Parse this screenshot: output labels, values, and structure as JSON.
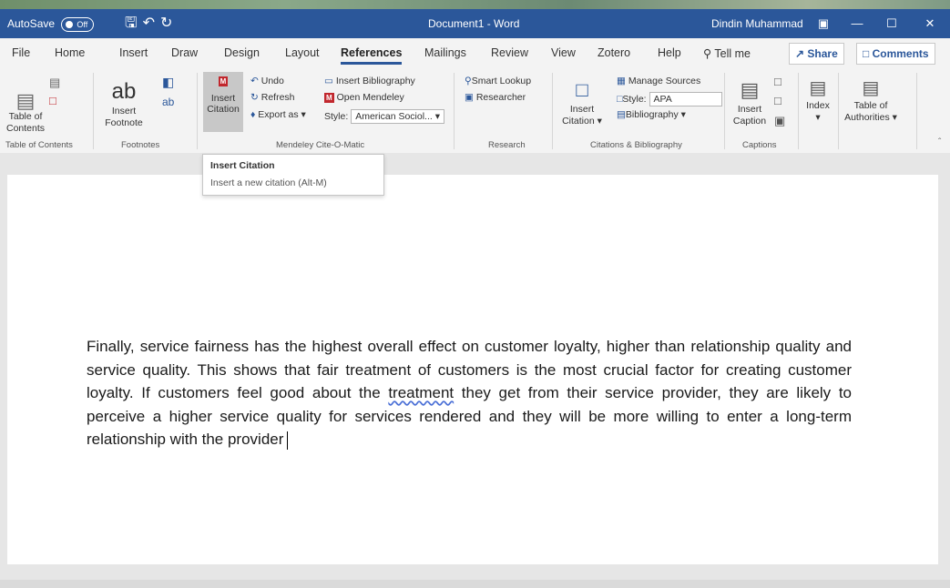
{
  "titlebar": {
    "autosave_label": "AutoSave",
    "autosave_state": "Off",
    "document_title": "Document1 - Word",
    "user_name": "Dindin Muhammad"
  },
  "tabs": [
    "File",
    "Home",
    "Insert",
    "Draw",
    "Design",
    "Layout",
    "References",
    "Mailings",
    "Review",
    "View",
    "Zotero",
    "Help"
  ],
  "active_tab": "References",
  "tell_me": "Tell me",
  "share_label": "Share",
  "comments_label": "Comments",
  "ribbon": {
    "toc": {
      "label1": "Table of",
      "label2": "Contents",
      "group": "Table of Contents"
    },
    "footnotes": {
      "label1": "Insert",
      "label2": "Footnote",
      "group": "Footnotes"
    },
    "mendeley": {
      "insert_citation1": "Insert",
      "insert_citation2": "Citation",
      "undo": "Undo",
      "refresh": "Refresh",
      "export_as": "Export as",
      "insert_bibliography": "Insert Bibliography",
      "open_mendeley": "Open Mendeley",
      "style_label": "Style:",
      "style_value": "American Sociol...",
      "group": "Mendeley Cite-O-Matic"
    },
    "research": {
      "smart_lookup": "Smart Lookup",
      "researcher": "Researcher",
      "group": "Research"
    },
    "citations": {
      "insert1": "Insert",
      "insert2": "Citation",
      "manage_sources": "Manage Sources",
      "style_label": "Style:",
      "style_value": "APA",
      "bibliography": "Bibliography",
      "group": "Citations & Bibliography"
    },
    "captions": {
      "label1": "Insert",
      "label2": "Caption",
      "group": "Captions"
    },
    "index": {
      "label": "Index"
    },
    "authorities": {
      "label1": "Table of",
      "label2": "Authorities"
    }
  },
  "tooltip": {
    "title": "Insert Citation",
    "description": "Insert a new citation (Alt-M)"
  },
  "document": {
    "text_before": "Finally, service fairness has the highest overall effect on customer loyalty, higher than relationship quality and service quality. This shows that fair treatment of customers is the most crucial factor for creating customer loyalty. If customers feel good about the ",
    "underlined_word": "treatment",
    "text_after": " they get from their service provider, they are likely to perceive a higher service quality for services rendered and they will be more willing to enter a long-term relationship with the provider"
  }
}
